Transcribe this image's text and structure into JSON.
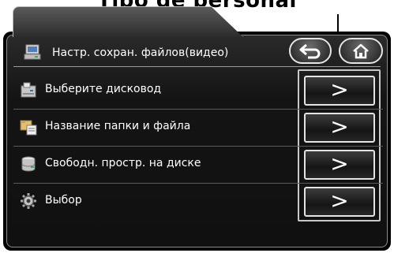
{
  "header": {
    "caption": "Tipo de personal",
    "title": "Настр. сохран. файлов(видео)",
    "back_icon": "back-arrow-icon",
    "home_icon": "home-icon"
  },
  "menu": {
    "items": [
      {
        "label": "Выберите дисковод",
        "icon": "drive-select-icon",
        "arrow": ">"
      },
      {
        "label": "Название папки и файла",
        "icon": "folder-file-icon",
        "arrow": ">"
      },
      {
        "label": "Свободн. простр. на диске",
        "icon": "disk-space-icon",
        "arrow": ">"
      },
      {
        "label": "Выбор",
        "icon": "gear-icon",
        "arrow": ">"
      }
    ]
  },
  "colors": {
    "background": "#000000",
    "text": "#ffffff",
    "border": "#e4e4e4"
  }
}
